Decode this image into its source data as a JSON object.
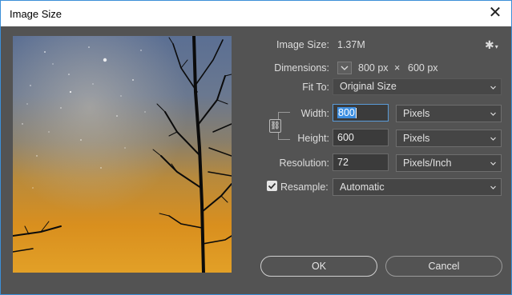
{
  "window": {
    "title": "Image Size",
    "close_glyph": "✕"
  },
  "info": {
    "image_size_label": "Image Size:",
    "image_size_value": "1.37M",
    "dimensions_label": "Dimensions:",
    "dimensions_width": "800 px",
    "dimensions_x": "×",
    "dimensions_height": "600 px",
    "gear_glyph": "✱"
  },
  "fit_to": {
    "label": "Fit To:",
    "value": "Original Size"
  },
  "width": {
    "label": "Width:",
    "value": "800",
    "unit": "Pixels"
  },
  "height": {
    "label": "Height:",
    "value": "600",
    "unit": "Pixels"
  },
  "resolution": {
    "label": "Resolution:",
    "value": "72",
    "unit": "Pixels/Inch"
  },
  "resample": {
    "label": "Resample:",
    "checked": true,
    "value": "Automatic"
  },
  "buttons": {
    "ok": "OK",
    "cancel": "Cancel"
  },
  "colors": {
    "dialog_bg": "#535353",
    "field_bg": "#3b3b3b",
    "focus_border": "#5a9bd8",
    "window_border": "#3c8fd8"
  },
  "icons": [
    "close-icon",
    "gear-icon",
    "chevron-down-icon",
    "link-icon",
    "check-icon"
  ]
}
